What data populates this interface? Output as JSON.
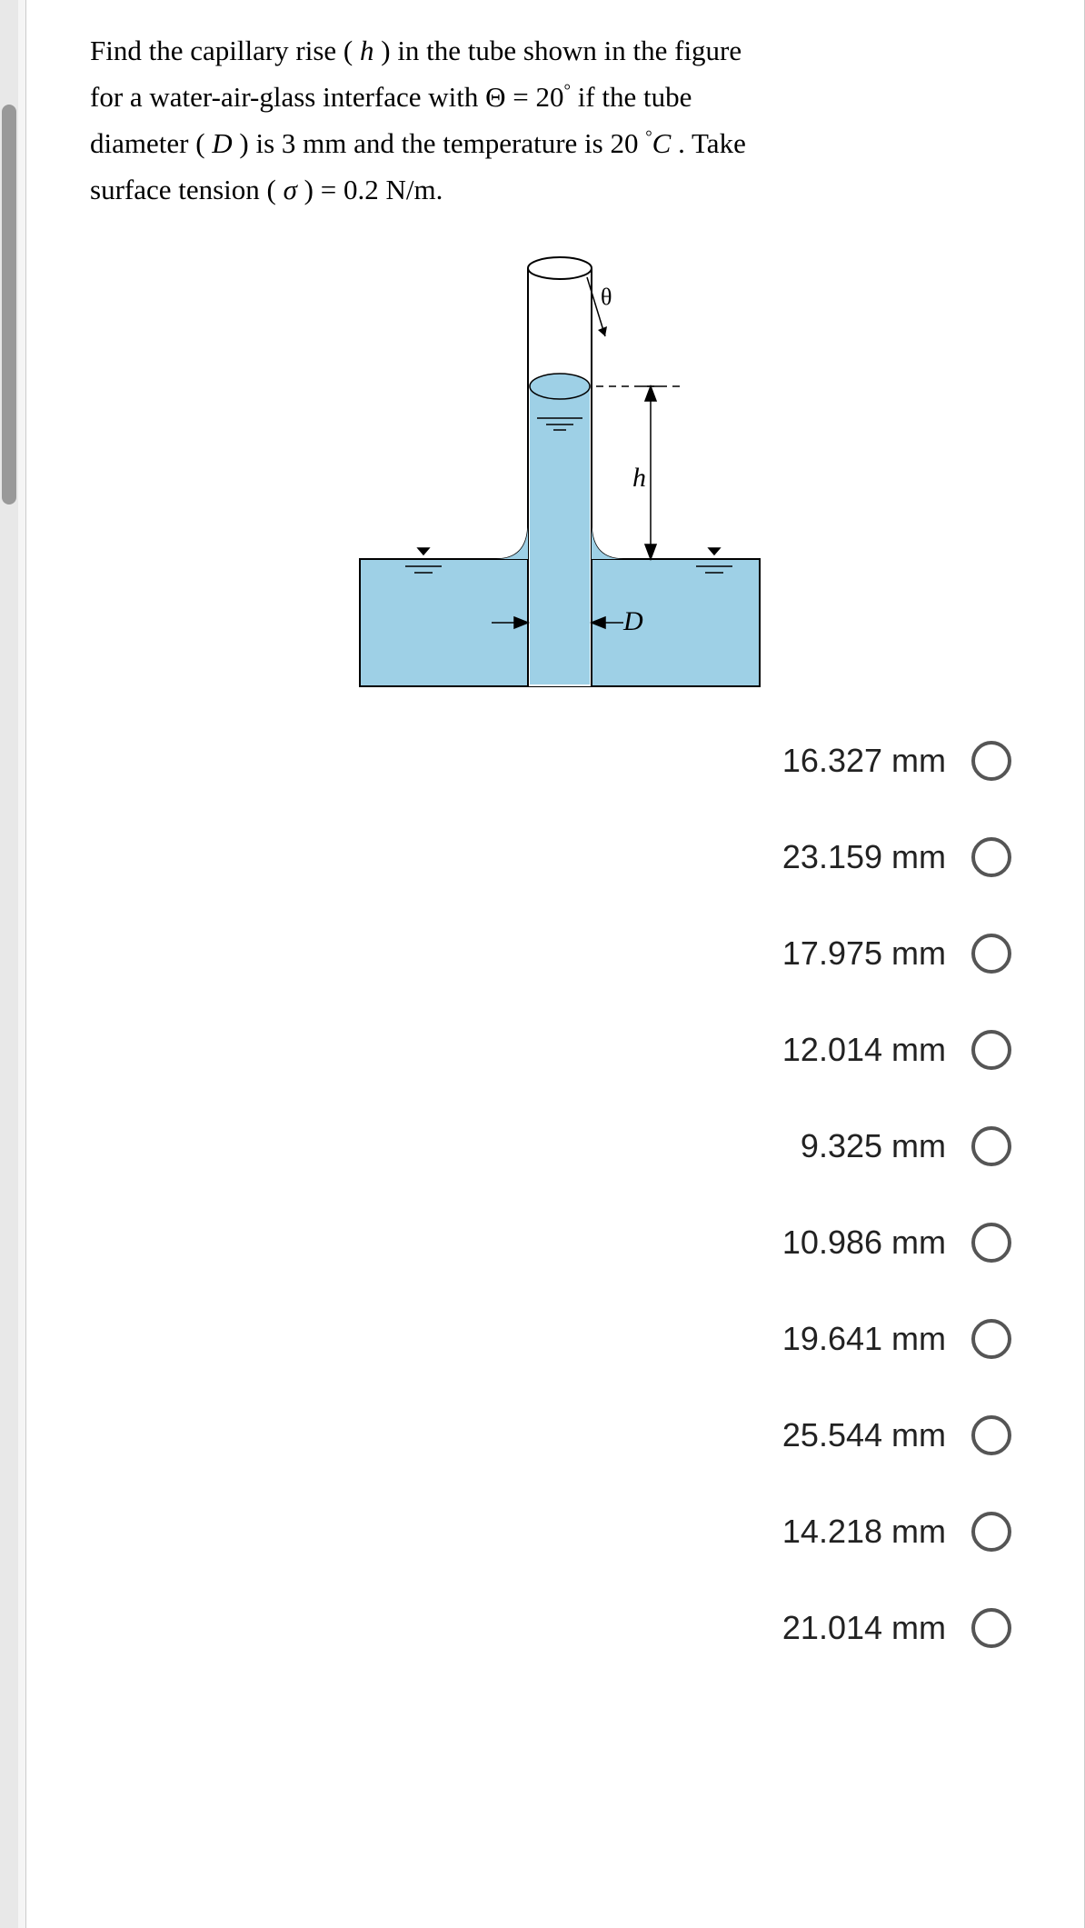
{
  "question": {
    "line1_a": "Find the capillary rise ( ",
    "line1_b": " ) in the tube shown in the figure",
    "line2_a": "for a water-air-glass interface with  ",
    "line2_b": "Θ",
    "line2_c": " =  20",
    "line2_d": " if the tube",
    "line3_a": "diameter ( ",
    "line3_b": " ) is 3 mm and the temperature is 20 ",
    "line3_c": "C",
    "line3_d": " . Take",
    "line4_a": "surface tension ( ",
    "line4_b": "σ",
    "line4_c": " ) = 0.2 N/m.",
    "var_h": "h",
    "var_D": "D",
    "deg": "°"
  },
  "figure": {
    "label_theta": "θ",
    "label_h": "h",
    "label_D": "D"
  },
  "options": [
    {
      "label": "16.327 mm"
    },
    {
      "label": "23.159 mm"
    },
    {
      "label": "17.975 mm"
    },
    {
      "label": "12.014 mm"
    },
    {
      "label": "9.325 mm"
    },
    {
      "label": "10.986 mm"
    },
    {
      "label": "19.641 mm"
    },
    {
      "label": "25.544 mm"
    },
    {
      "label": "14.218 mm"
    },
    {
      "label": "21.014 mm"
    }
  ]
}
